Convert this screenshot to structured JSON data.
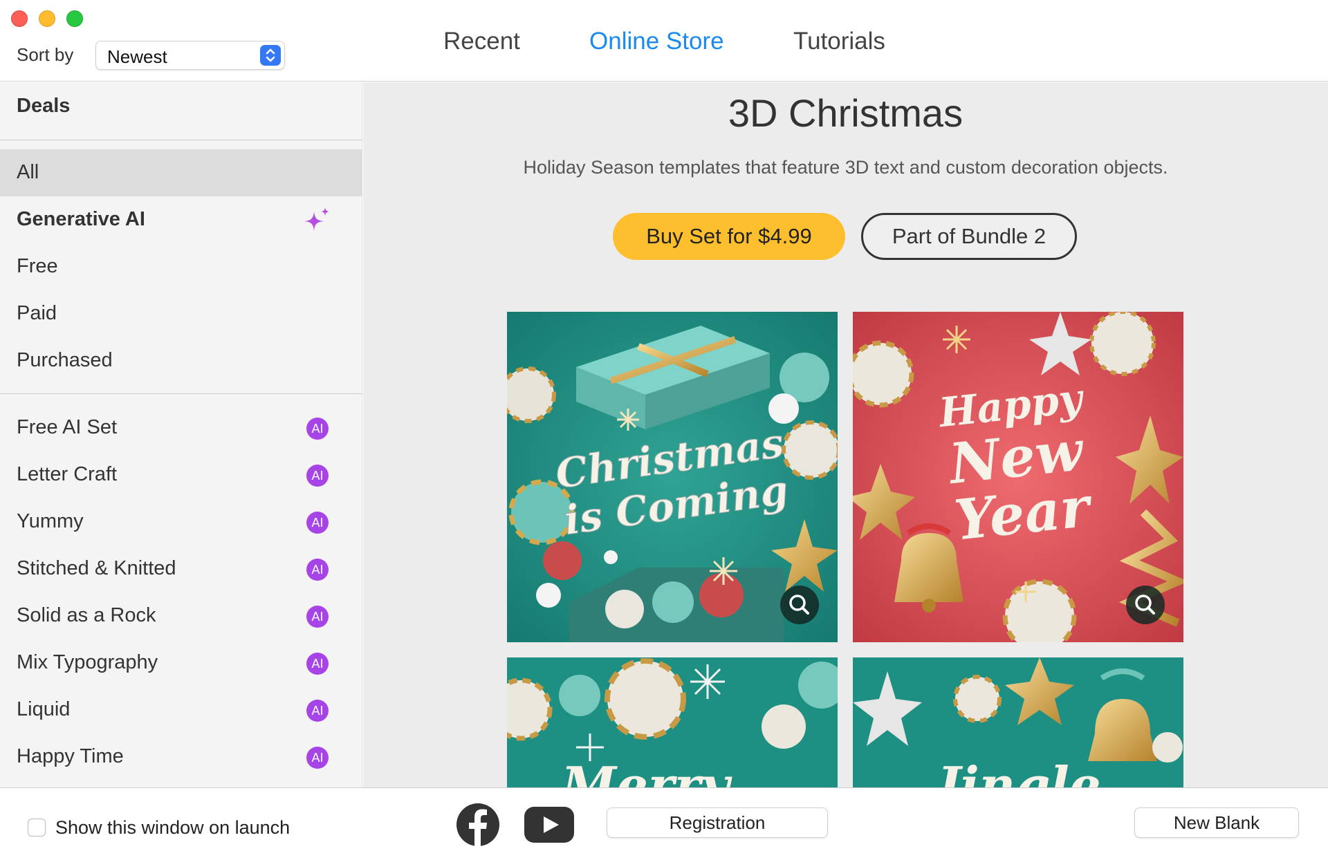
{
  "window": {
    "sort_label": "Sort by",
    "sort_value": "Newest"
  },
  "tabs": [
    {
      "label": "Recent",
      "active": false
    },
    {
      "label": "Online Store",
      "active": true
    },
    {
      "label": "Tutorials",
      "active": false
    }
  ],
  "sidebar": {
    "heading": "Deals",
    "filters": [
      {
        "label": "All",
        "selected": true
      },
      {
        "label": "Generative AI",
        "icon": "sparkle-icon"
      },
      {
        "label": "Free"
      },
      {
        "label": "Paid"
      },
      {
        "label": "Purchased"
      }
    ],
    "sets": [
      {
        "label": "Free AI Set",
        "badge": "AI"
      },
      {
        "label": "Letter Craft",
        "badge": "AI"
      },
      {
        "label": "Yummy",
        "badge": "AI"
      },
      {
        "label": "Stitched & Knitted",
        "badge": "AI"
      },
      {
        "label": "Solid as a Rock",
        "badge": "AI"
      },
      {
        "label": "Mix Typography",
        "badge": "AI"
      },
      {
        "label": "Liquid",
        "badge": "AI"
      },
      {
        "label": "Happy Time",
        "badge": "AI"
      }
    ]
  },
  "main": {
    "title": "3D Christmas",
    "description": "Holiday Season templates that feature 3D text and custom decoration objects.",
    "buy_label": "Buy Set for $4.99",
    "bundle_label": "Part of Bundle 2",
    "templates": [
      {
        "line1": "Christmas",
        "line2": "is Coming",
        "background": "#1e8f83"
      },
      {
        "line1": "Happy",
        "line2": "New",
        "line3": "Year",
        "background": "#d9464f"
      },
      {
        "line1": "Merry",
        "background": "#1e8f83"
      },
      {
        "line1": "Jingle",
        "background": "#1e8f83"
      }
    ]
  },
  "footer": {
    "show_on_launch_label": "Show this window on launch",
    "show_on_launch_checked": false,
    "registration_label": "Registration",
    "new_blank_label": "New Blank"
  },
  "colors": {
    "accent_blue": "#1a8aef",
    "buy_yellow": "#fdbf2d",
    "ai_purple": "#a644e8"
  }
}
